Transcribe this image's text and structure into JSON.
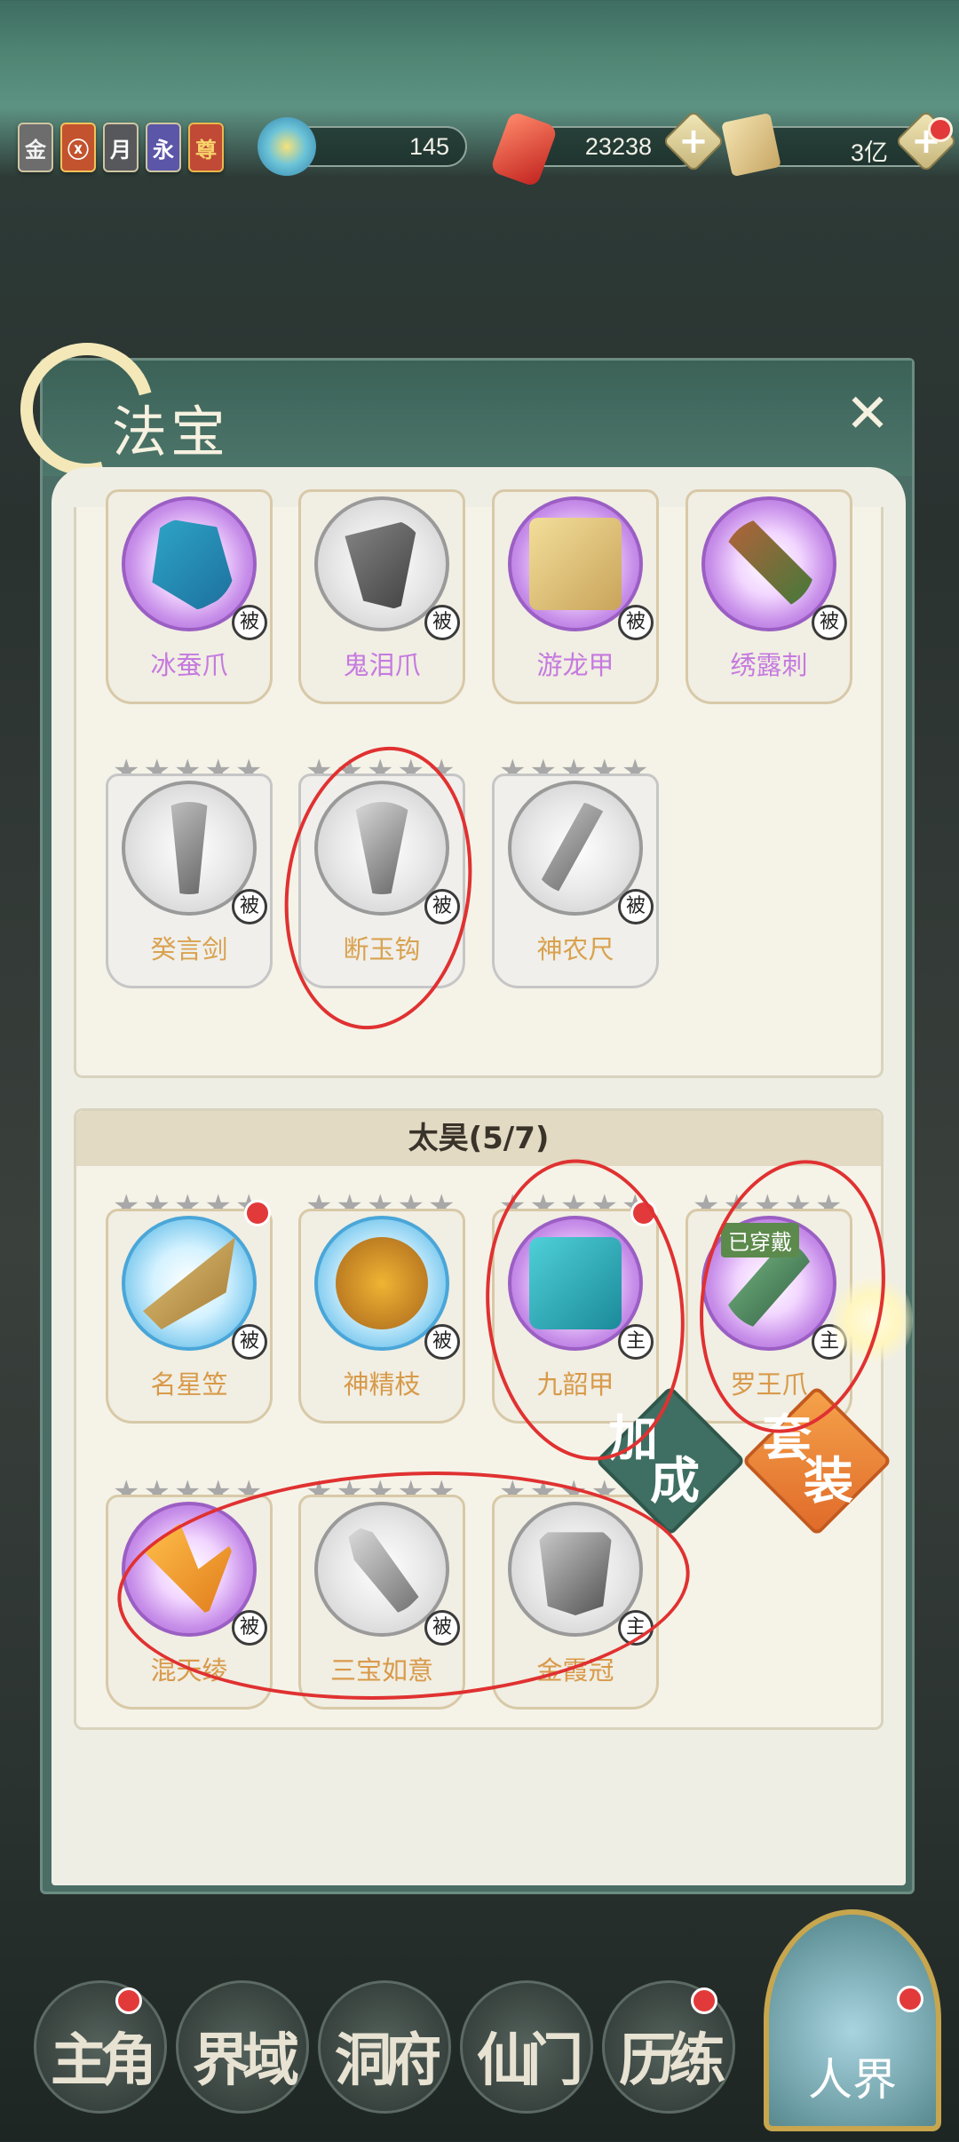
{
  "topbar": {
    "badges": [
      "金",
      "ⓧ",
      "月",
      "永",
      "尊"
    ],
    "resource1": {
      "icon": "swirl-coin-icon",
      "value": "145"
    },
    "resource2": {
      "icon": "red-crystal-icon",
      "value": "23238"
    },
    "resource3": {
      "icon": "scroll-icon",
      "value": "3亿"
    }
  },
  "panel": {
    "title": "法宝",
    "close": "✕"
  },
  "section1": {
    "items": [
      {
        "name": "冰蚕爪",
        "tag": "被",
        "orb": "purple",
        "name_color": "purple"
      },
      {
        "name": "鬼泪爪",
        "tag": "被",
        "orb": "grey",
        "name_color": "purple"
      },
      {
        "name": "游龙甲",
        "tag": "被",
        "orb": "purple",
        "name_color": "purple"
      },
      {
        "name": "绣露刺",
        "tag": "被",
        "orb": "purple",
        "name_color": "purple"
      },
      {
        "name": "癸言剑",
        "tag": "被",
        "orb": "grey",
        "name_color": "gold"
      },
      {
        "name": "断玉钩",
        "tag": "被",
        "orb": "grey",
        "name_color": "gold"
      },
      {
        "name": "神农尺",
        "tag": "被",
        "orb": "grey",
        "name_color": "gold"
      }
    ]
  },
  "section2": {
    "header": "太昊(5/7)",
    "items": [
      {
        "name": "名星笠",
        "tag": "被",
        "orb": "blue"
      },
      {
        "name": "神精枝",
        "tag": "被",
        "orb": "blue"
      },
      {
        "name": "九韶甲",
        "tag": "主",
        "orb": "purple"
      },
      {
        "name": "罗王爪",
        "tag": "主",
        "orb": "purple",
        "worn": "已穿戴"
      },
      {
        "name": "混天绫",
        "tag": "被",
        "orb": "purple"
      },
      {
        "name": "三宝如意",
        "tag": "被",
        "orb": "grey"
      },
      {
        "name": "金霞冠",
        "tag": "主",
        "orb": "grey"
      }
    ]
  },
  "actions": {
    "bonus": [
      "加",
      "成"
    ],
    "set": [
      "套",
      "装"
    ]
  },
  "nav": {
    "items": [
      "主角",
      "界域",
      "洞府",
      "仙门",
      "历练"
    ],
    "realm": "人界"
  },
  "colors": {
    "accent": "#e23a3a",
    "panel": "#4a6e66",
    "gold_name": "#d89a4a",
    "purple_name": "#c57adf"
  }
}
